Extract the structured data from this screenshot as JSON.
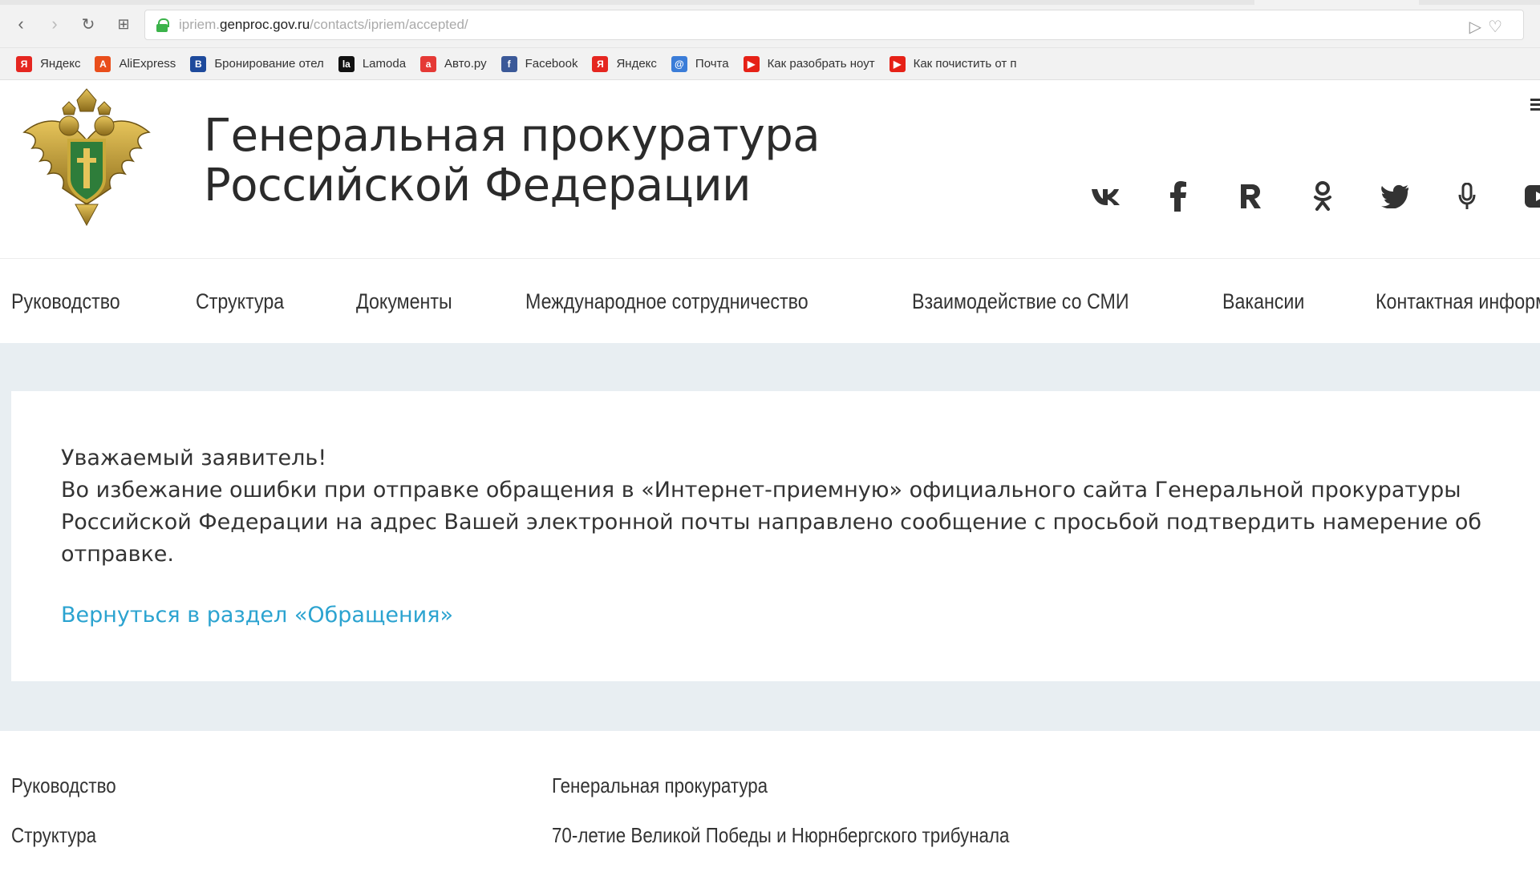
{
  "browser": {
    "url_prefix": "ipriem.",
    "url_host": "genproc.gov.ru",
    "url_path": "/contacts/ipriem/accepted/",
    "bookmarks": [
      {
        "label": "Яндекс",
        "icon": "yandex-icon",
        "color": "#e52620",
        "glyph": "Я"
      },
      {
        "label": "AliExpress",
        "icon": "aliexpress-icon",
        "color": "#e94e1b",
        "glyph": "A"
      },
      {
        "label": "Бронирование отел",
        "icon": "booking-icon",
        "color": "#1e4a9c",
        "glyph": "B"
      },
      {
        "label": "Lamoda",
        "icon": "lamoda-icon",
        "color": "#111111",
        "glyph": "la"
      },
      {
        "label": "Авто.ру",
        "icon": "autoru-icon",
        "color": "#e53935",
        "glyph": "a"
      },
      {
        "label": "Facebook",
        "icon": "facebook-icon",
        "color": "#3b5998",
        "glyph": "f"
      },
      {
        "label": "Яндекс",
        "icon": "yandex-icon",
        "color": "#e52620",
        "glyph": "Я"
      },
      {
        "label": "Почта",
        "icon": "mail-icon",
        "color": "#3b7dd8",
        "glyph": "@"
      },
      {
        "label": "Как разобрать ноут",
        "icon": "youtube-icon",
        "color": "#e62117",
        "glyph": "▶"
      },
      {
        "label": "Как почистить от п",
        "icon": "youtube-icon",
        "color": "#e62117",
        "glyph": "▶"
      }
    ]
  },
  "header": {
    "title_line1": "Генеральная прокуратура",
    "title_line2": "Российской Федерации",
    "socials": [
      {
        "name": "vk-icon",
        "glyph": "vk"
      },
      {
        "name": "facebook-icon",
        "glyph": "f"
      },
      {
        "name": "rutube-icon",
        "glyph": "R"
      },
      {
        "name": "odnoklassniki-icon",
        "glyph": "ok"
      },
      {
        "name": "twitter-icon",
        "glyph": "tw"
      },
      {
        "name": "podcast-icon",
        "glyph": "mic"
      },
      {
        "name": "youtube-icon",
        "glyph": "yt"
      }
    ]
  },
  "nav": {
    "items": [
      "Руководство",
      "Структура",
      "Документы",
      "Международное сотрудничество",
      "Взаимодействие со СМИ",
      "Вакансии",
      "Контактная информация"
    ]
  },
  "main": {
    "greeting": "Уважаемый заявитель!",
    "message": "Во избежание ошибки при отправке обращения в «Интернет-приемную» официального сайта Генеральной прокуратуры Российской Федерации на адрес Вашей электронной почты направлено сообщение с просьбой подтвердить намерение об отправке.",
    "back_link": "Вернуться в раздел «Обращения»",
    "link_color": "#2ba3d0"
  },
  "footer": {
    "left": [
      "Руководство",
      "Структура"
    ],
    "right": [
      "Генеральная прокуратура",
      "70-летие Великой Победы и Нюрнбергского трибунала"
    ]
  }
}
